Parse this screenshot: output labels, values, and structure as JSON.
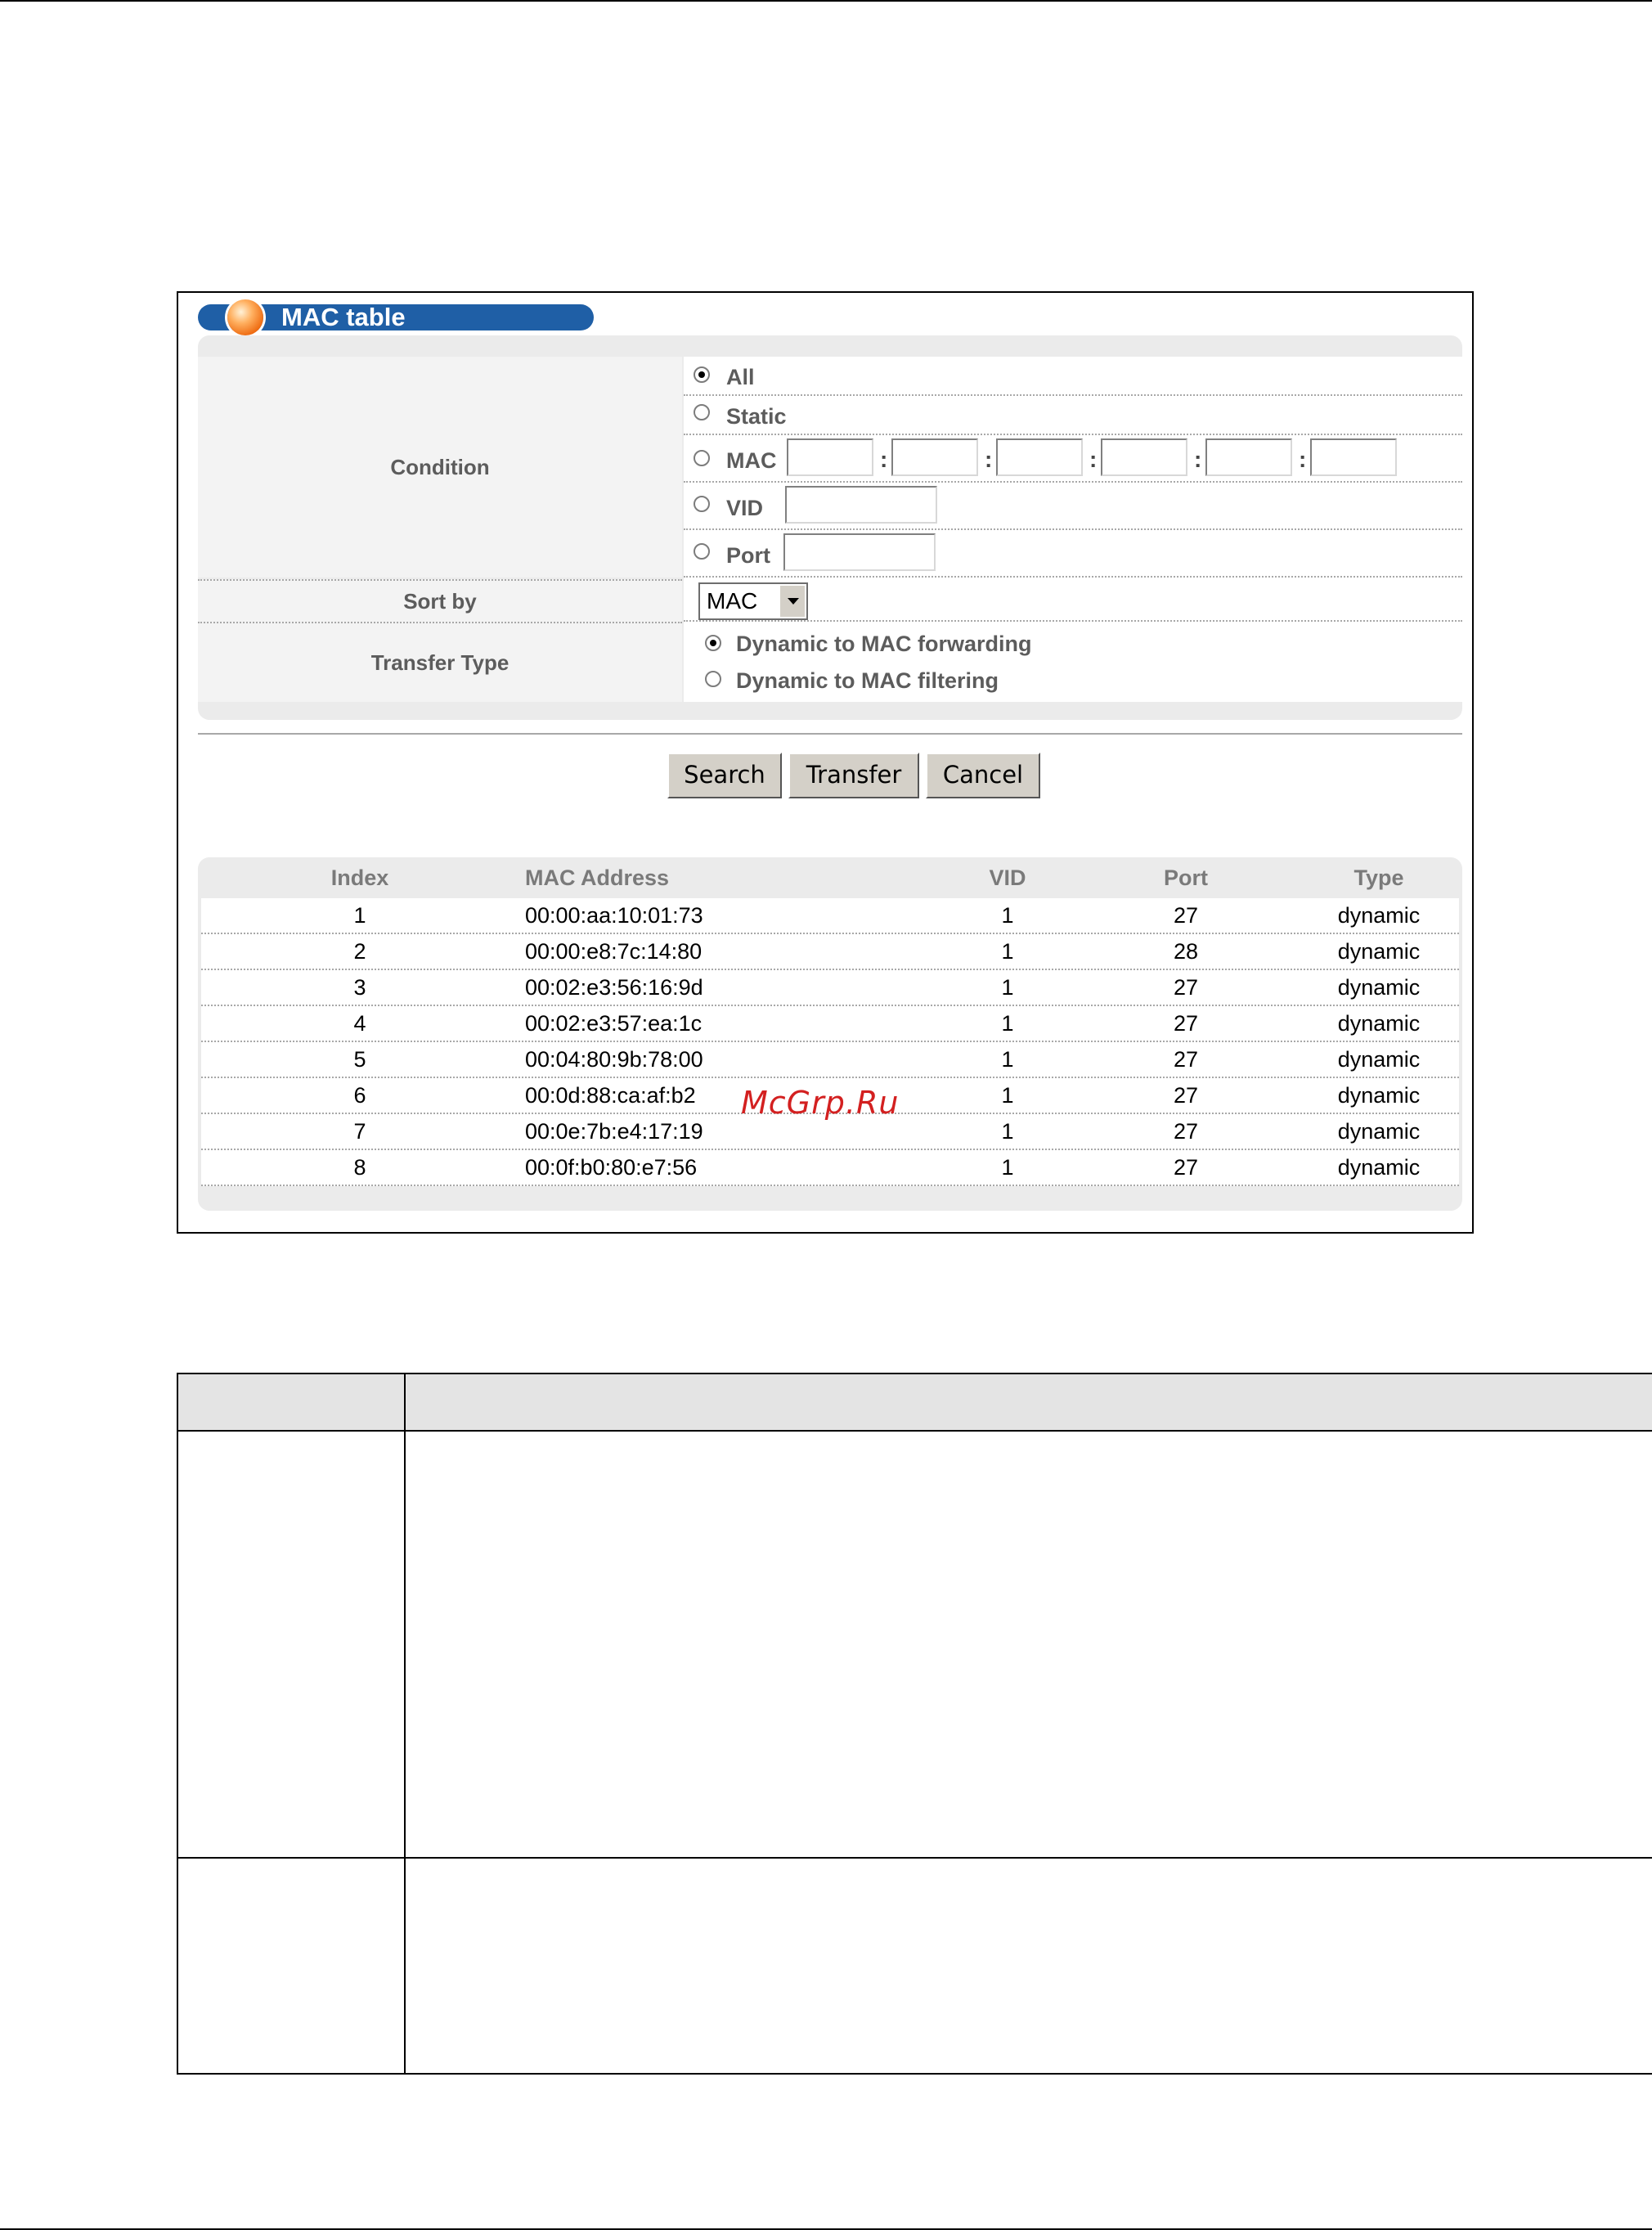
{
  "window": {
    "title": "MAC table"
  },
  "colors": {
    "title_bar": "#1f5fa6",
    "panel": "#ebebeb",
    "label_text": "#5c5c5c",
    "watermark": "#d32020"
  },
  "form": {
    "condition_label": "Condition",
    "options": {
      "all": "All",
      "static": "Static",
      "mac": "MAC",
      "vid": "VID",
      "port": "Port"
    },
    "selected_condition": "All",
    "mac_fields": [
      "",
      "",
      "",
      "",
      "",
      ""
    ],
    "mac_separator": ":",
    "vid_value": "",
    "port_value": "",
    "sort_by_label": "Sort by",
    "sort_by_value": "MAC",
    "transfer_type_label": "Transfer Type",
    "transfer_options": {
      "forwarding": "Dynamic to MAC forwarding",
      "filtering": "Dynamic to MAC filtering"
    },
    "selected_transfer": "Dynamic to MAC forwarding"
  },
  "buttons": {
    "search": "Search",
    "transfer": "Transfer",
    "cancel": "Cancel"
  },
  "table": {
    "headers": {
      "index": "Index",
      "mac": "MAC Address",
      "vid": "VID",
      "port": "Port",
      "type": "Type"
    },
    "rows": [
      {
        "index": "1",
        "mac": "00:00:aa:10:01:73",
        "vid": "1",
        "port": "27",
        "type": "dynamic"
      },
      {
        "index": "2",
        "mac": "00:00:e8:7c:14:80",
        "vid": "1",
        "port": "28",
        "type": "dynamic"
      },
      {
        "index": "3",
        "mac": "00:02:e3:56:16:9d",
        "vid": "1",
        "port": "27",
        "type": "dynamic"
      },
      {
        "index": "4",
        "mac": "00:02:e3:57:ea:1c",
        "vid": "1",
        "port": "27",
        "type": "dynamic"
      },
      {
        "index": "5",
        "mac": "00:04:80:9b:78:00",
        "vid": "1",
        "port": "27",
        "type": "dynamic"
      },
      {
        "index": "6",
        "mac": "00:0d:88:ca:af:b2",
        "vid": "1",
        "port": "27",
        "type": "dynamic"
      },
      {
        "index": "7",
        "mac": "00:0e:7b:e4:17:19",
        "vid": "1",
        "port": "27",
        "type": "dynamic"
      },
      {
        "index": "8",
        "mac": "00:0f:b0:80:e7:56",
        "vid": "1",
        "port": "27",
        "type": "dynamic"
      }
    ]
  },
  "watermark": "McGrp.Ru"
}
